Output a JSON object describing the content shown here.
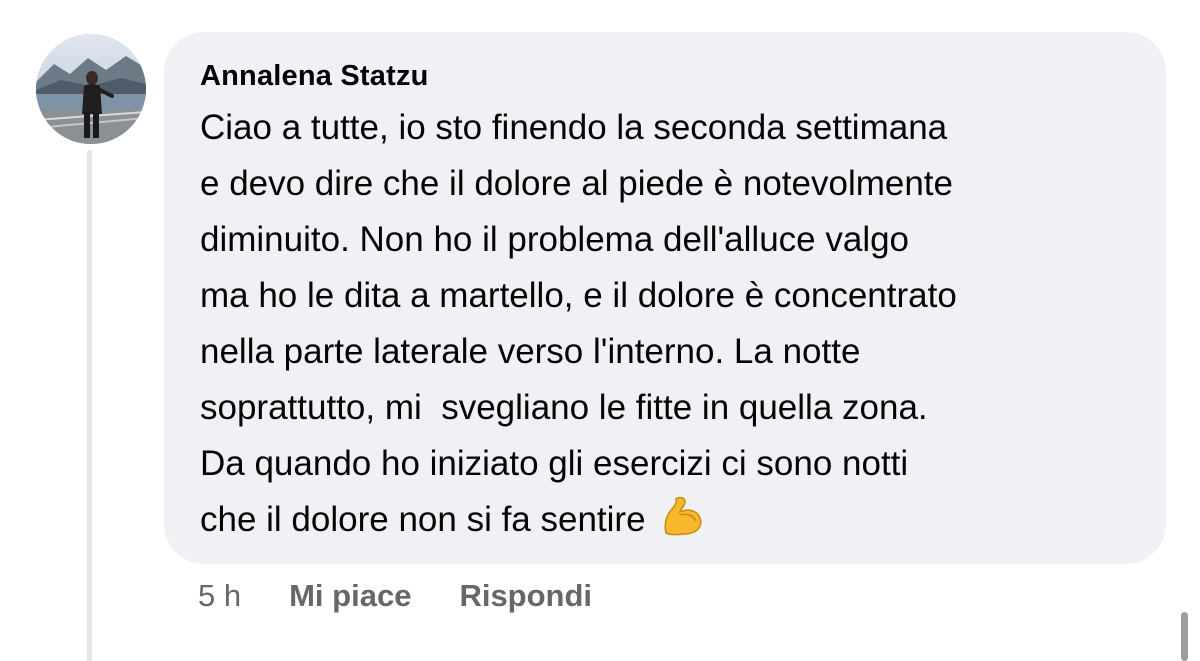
{
  "comment": {
    "author": "Annalena Statzu",
    "lines": [
      "Ciao a tutte, io sto finendo la seconda settimana",
      "e devo dire che il dolore al piede è notevolmente",
      "diminuito. Non ho il problema dell'alluce valgo",
      "ma ho le dita a martello, e il dolore è concentrato",
      "nella parte laterale verso l'interno. La notte",
      "soprattutto, mi  svegliano le fitte in quella zona.",
      "Da quando ho iniziato gli esercizi ci sono notti",
      "che il dolore non si fa sentire"
    ],
    "emoji": "flexed-biceps-icon",
    "bubble_color": "#eff1f4"
  },
  "actions": {
    "time": "5 h",
    "like_label": "Mi piace",
    "reply_label": "Rispondi",
    "text_color": "#65676b"
  }
}
